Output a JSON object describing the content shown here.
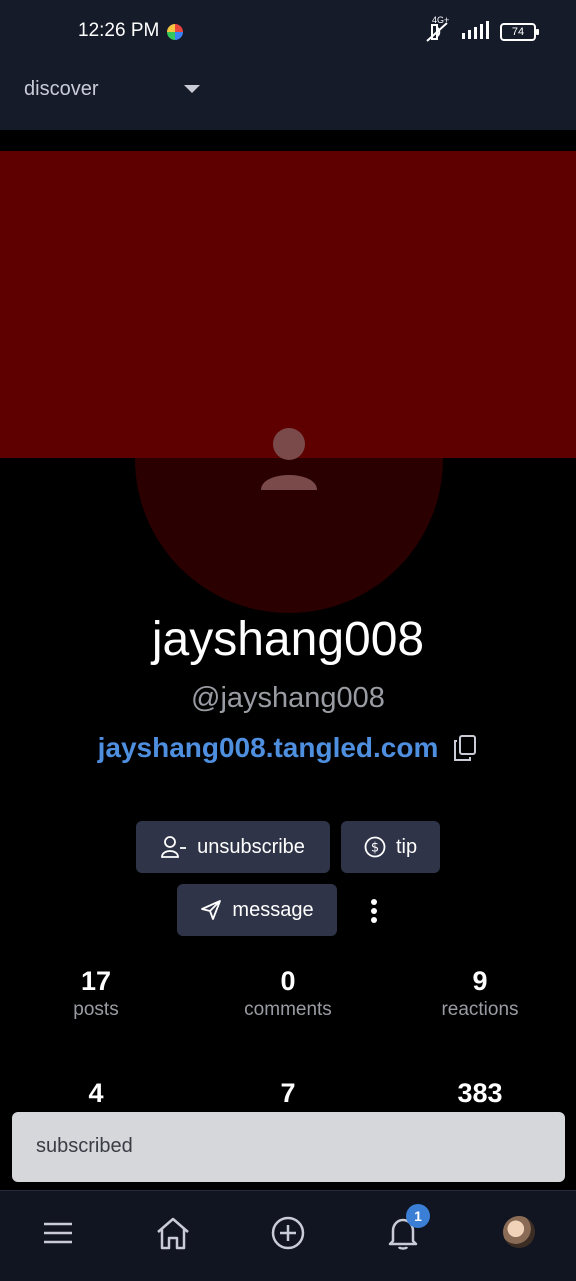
{
  "status_bar": {
    "time": "12:26 PM",
    "network": "4G+",
    "battery": "74"
  },
  "header": {
    "feed_selector": "discover"
  },
  "profile": {
    "display_name": "jayshang008",
    "handle": "@jayshang008",
    "domain": "jayshang008.tangled.com",
    "banner_color": "#5f0000"
  },
  "actions": {
    "unsubscribe": "unsubscribe",
    "tip": "tip",
    "message": "message"
  },
  "stats_row1": [
    {
      "value": "17",
      "label": "posts"
    },
    {
      "value": "0",
      "label": "comments"
    },
    {
      "value": "9",
      "label": "reactions"
    }
  ],
  "stats_row2": [
    {
      "value": "4",
      "label": ""
    },
    {
      "value": "7",
      "label": ""
    },
    {
      "value": "383",
      "label": ""
    }
  ],
  "toast": {
    "text": "subscribed"
  },
  "bottom_nav": {
    "items": [
      "menu-icon",
      "home-icon",
      "add-circle-icon",
      "bell-icon",
      "profile-avatar"
    ],
    "notification_count": "1"
  },
  "colors": {
    "accent": "#4f8fe0",
    "button_bg": "#2f3448",
    "badge": "#3a7fd5"
  }
}
